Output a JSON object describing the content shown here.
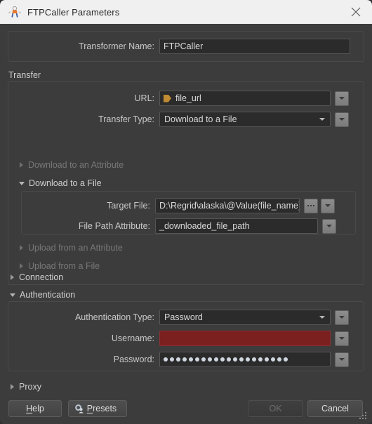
{
  "window": {
    "title": "FTPCaller Parameters",
    "icon": "transformer-icon",
    "close_icon": "close-icon"
  },
  "transformer": {
    "label": "Transformer Name:",
    "value": "FTPCaller"
  },
  "transfer": {
    "caption": "Transfer",
    "url": {
      "label": "URL:",
      "value": "file_url",
      "icon": "attribute-icon"
    },
    "transfer_type": {
      "label": "Transfer Type:",
      "value": "Download to a File"
    },
    "sections": [
      {
        "label": "Download to an Attribute",
        "expanded": false,
        "enabled": false
      },
      {
        "label": "Download to a File",
        "expanded": true,
        "enabled": true
      },
      {
        "label": "Upload from an Attribute",
        "expanded": false,
        "enabled": false
      },
      {
        "label": "Upload from a File",
        "expanded": false,
        "enabled": false
      }
    ],
    "target_file": {
      "label": "Target File:",
      "value": "D:\\Regrid\\alaska\\@Value(file_name)",
      "browse_label": "..."
    },
    "file_path_attribute": {
      "label": "File Path Attribute:",
      "value": "_downloaded_file_path"
    }
  },
  "connection": {
    "label": "Connection",
    "expanded": false
  },
  "authentication": {
    "label": "Authentication",
    "expanded": true,
    "auth_type": {
      "label": "Authentication Type:",
      "value": "Password"
    },
    "username": {
      "label": "Username:",
      "value": "",
      "state": "error",
      "error_color": "#7b1f1f"
    },
    "password": {
      "label": "Password:",
      "masked_length": 20
    }
  },
  "proxy": {
    "label": "Proxy",
    "expanded": false
  },
  "footer": {
    "help": "Help",
    "help_mnemonic": "H",
    "presets": "Presets",
    "presets_mnemonic": "P",
    "ok": "OK",
    "ok_enabled": false,
    "cancel": "Cancel"
  }
}
